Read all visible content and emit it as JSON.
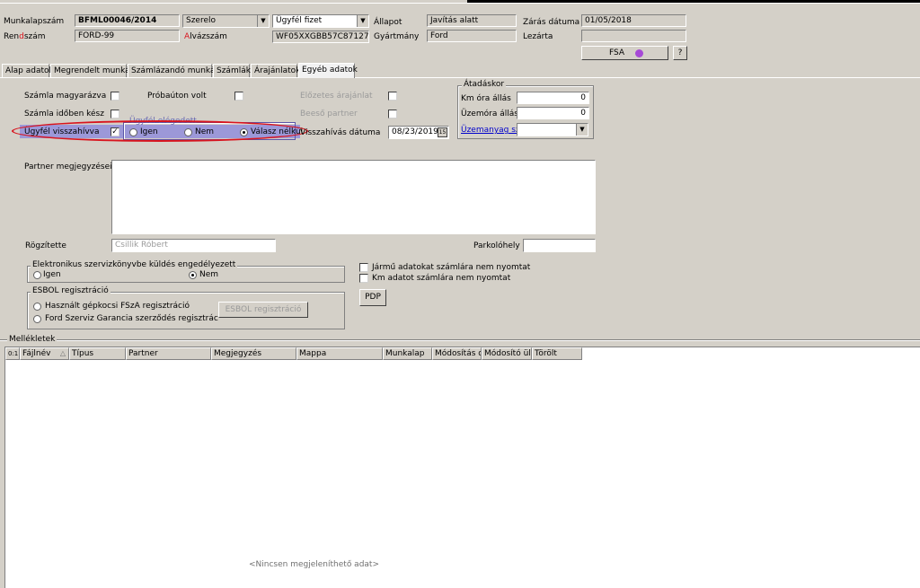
{
  "header": {
    "munkalapszam_label": "Munkalapszám",
    "munkalapszam_value": "BFML00046/2014",
    "rendszam_label_1": "Ren",
    "rendszam_label_2": "d",
    "rendszam_label_3": "szám",
    "rendszam_value": "FORD-99",
    "szerelo_value": "Szerelo",
    "fizetes_value": "Ügyfél fizet",
    "alvazszam_label_1": "A",
    "alvazszam_label_2": "lvázszám",
    "alvazszam_value": "WF05XXGBB57C87127",
    "allapot_label": "Állapot",
    "allapot_value": "Javítás alatt",
    "gyartmany_label": "Gyártmány",
    "gyartmany_value": "Ford",
    "zaras_label": "Zárás dátuma",
    "zaras_value": "01/05/2018",
    "lezarta_label": "Lezárta",
    "lezarta_value": "",
    "fsa_label": "FSA",
    "help_label": "?"
  },
  "tabs": [
    {
      "label": "Alap adatok"
    },
    {
      "label": "Megrendelt munkák"
    },
    {
      "label": "Számlázandó munkák"
    },
    {
      "label": "Számlák"
    },
    {
      "label": "Árajánlatok"
    },
    {
      "label": "Egyéb adatok"
    }
  ],
  "form": {
    "szamla_magyarazva": "Számla magyarázva",
    "probauton_volt": "Próbaúton volt",
    "elozetes_arajanlat": "Előzetes árajánlat",
    "szamla_idoben_kesz": "Számla időben kész",
    "beeso_partner": "Beeső partner",
    "ugyfel_visszahivva": "Ügyfél visszahívva",
    "ugyfel_elegedett": "Ügyfél elégedett",
    "igen": "Igen",
    "nem": "Nem",
    "valasz_nelkul": "Válasz nélkül",
    "visszahivas_datuma_1": "V",
    "visszahivas_datuma_2": "isszahívás dátuma",
    "visszahivas_value": "08/23/2019",
    "calendar_glyph": "15",
    "partner_megjegyzesei": "Partner megjegyzései",
    "partner_text": "",
    "rogzitette": "Rögzítette",
    "rogzitette_value": "Csillik Róbert",
    "parkolohely": "Parkolóhely",
    "parkolohely_value": ""
  },
  "atadaskor": {
    "title": "Átadáskor",
    "km_ora_allas": "Km óra állás",
    "km_value": "0",
    "uzemora_allasa": "Üzemóra állása",
    "uzemora_value": "0",
    "uzemanyag_szint": "Üzemanyag szint",
    "uzemanyag_value": ""
  },
  "elektronikus": {
    "title": "Elektronikus szervizkönyvbe küldés engedélyezett",
    "igen": "Igen",
    "nem": "Nem"
  },
  "nyomtat": {
    "jarmu": "Jármű adatokat számlára nem nyomtat",
    "km": "Km adatot számlára nem nyomtat",
    "pdp": "PDP"
  },
  "esbol": {
    "title": "ESBOL regisztráció",
    "option1": "Használt gépkocsi FSzA regisztráció",
    "option2": "Ford Szerviz Garancia szerződés regisztrác",
    "button": "ESBOL regisztráció"
  },
  "mellekletek": {
    "title": "Mellékletek",
    "columns": [
      {
        "label": "0:1"
      },
      {
        "label": "Fájlnév"
      },
      {
        "label": "Típus"
      },
      {
        "label": "Partner"
      },
      {
        "label": "Megjegyzés"
      },
      {
        "label": "Mappa"
      },
      {
        "label": "Munkalap"
      },
      {
        "label": "Módosítás dá"
      },
      {
        "label": "Módosító ül."
      },
      {
        "label": "Törölt"
      }
    ],
    "sort_glyph": "△",
    "empty_text": "<Nincsen megjeleníthető adat>"
  },
  "colors": {
    "window": "#d4d0c8",
    "highlight_band": "#9c98d8",
    "annotation_red": "#d8141e",
    "link_blue": "#0000cc"
  },
  "icons": {
    "fsa": "fsa-bug-icon",
    "calendar": "calendar-icon"
  }
}
